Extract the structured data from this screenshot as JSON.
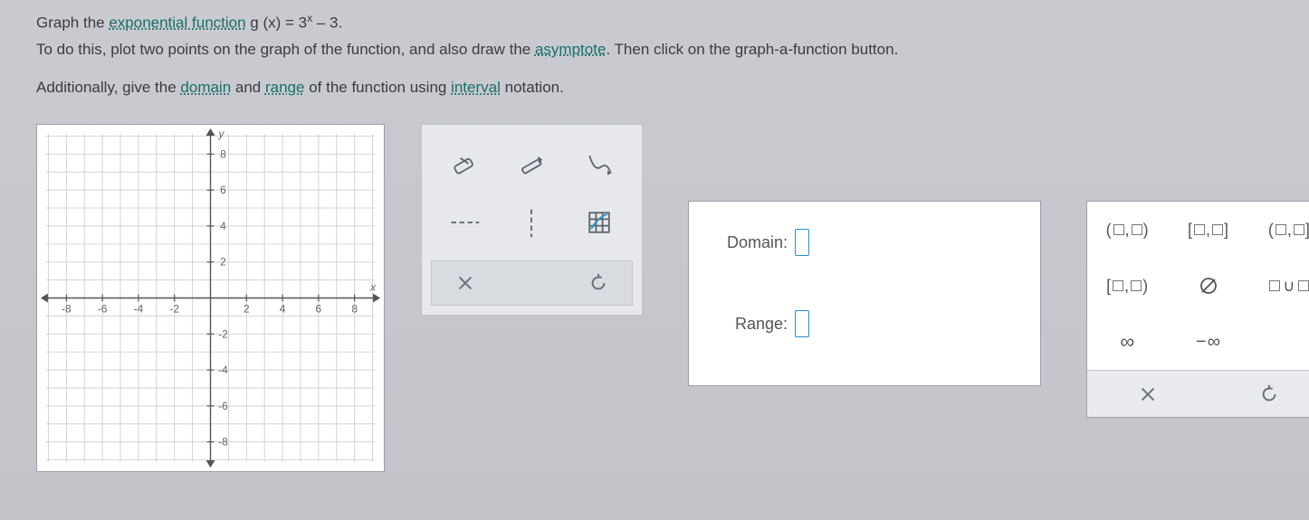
{
  "instructions": {
    "line1_pre": "Graph the ",
    "link1": "exponential function",
    "line1_func": " g (x) = 3",
    "line1_exp": "x",
    "line1_post": " – 3.",
    "line2_pre": "To do this, plot two points on the graph of the function, and also draw the ",
    "link2": "asymptote",
    "line2_post": ". Then click on the graph-a-function button.",
    "line3_pre": "Additionally, give the ",
    "link3": "domain",
    "line3_mid": " and ",
    "link4": "range",
    "line3_mid2": " of the function using ",
    "link5": "interval",
    "line3_post": " notation."
  },
  "graph": {
    "x_ticks": [
      -8,
      -6,
      -4,
      -2,
      2,
      4,
      6,
      8
    ],
    "y_ticks": [
      -8,
      -6,
      -4,
      -2,
      2,
      4,
      6,
      8
    ],
    "y_label": "y",
    "x_label": "x"
  },
  "dr": {
    "domain_label": "Domain:",
    "range_label": "Range:"
  },
  "interval": {
    "oo": "(□,□)",
    "cc": "[□,□]",
    "oc": "(□,□]",
    "co": "[□,□)",
    "empty": "∅",
    "union": "□∪□",
    "inf": "∞",
    "neginf": "−∞"
  }
}
